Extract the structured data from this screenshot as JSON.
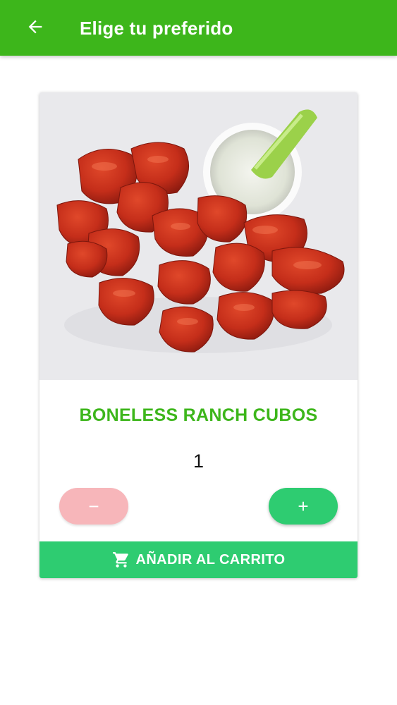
{
  "header": {
    "title": "Elige tu preferido",
    "back_icon": "arrow-left-icon",
    "background_color": "#3db61b"
  },
  "product": {
    "name": "BONELESS RANCH CUBOS",
    "image_alt": "boneless wings with ranch dip and celery",
    "quantity": "1",
    "decrement_label": "−",
    "increment_label": "+",
    "decrement_color": "#f7b6ba",
    "increment_color": "#2ecc71"
  },
  "cart": {
    "label": "AÑADIR AL CARRITO",
    "icon": "shopping-cart-icon",
    "color": "#2ecc71"
  }
}
